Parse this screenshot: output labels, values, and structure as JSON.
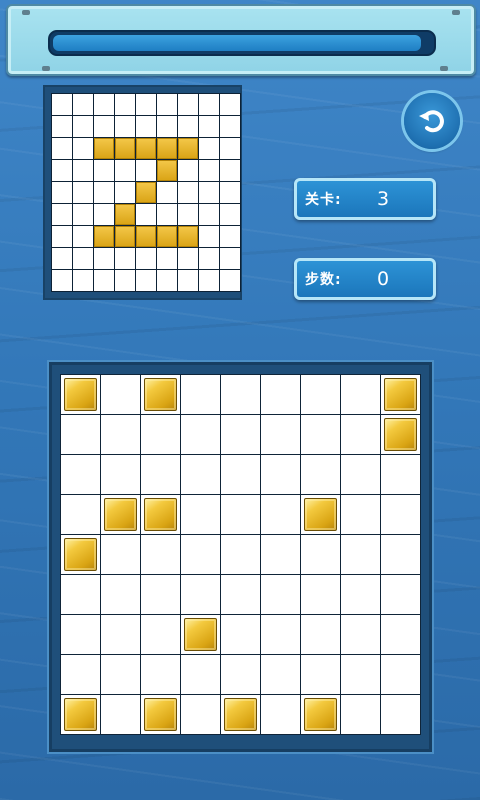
{
  "progress": {
    "fraction": 0.99
  },
  "level": {
    "label": "关卡:",
    "value": "3"
  },
  "steps": {
    "label": "步数:",
    "value": "0"
  },
  "refresh": {
    "icon": "refresh-icon"
  },
  "preview_grid": {
    "rows": 9,
    "cols": 9,
    "filled": [
      [
        2,
        2
      ],
      [
        2,
        3
      ],
      [
        2,
        4
      ],
      [
        2,
        5
      ],
      [
        2,
        6
      ],
      [
        3,
        5
      ],
      [
        4,
        4
      ],
      [
        5,
        3
      ],
      [
        6,
        2
      ],
      [
        6,
        3
      ],
      [
        6,
        4
      ],
      [
        6,
        5
      ],
      [
        6,
        6
      ]
    ]
  },
  "board_grid": {
    "rows": 9,
    "cols": 9,
    "filled": [
      [
        0,
        0
      ],
      [
        0,
        2
      ],
      [
        0,
        8
      ],
      [
        1,
        8
      ],
      [
        3,
        1
      ],
      [
        3,
        2
      ],
      [
        3,
        6
      ],
      [
        4,
        0
      ],
      [
        6,
        3
      ],
      [
        8,
        0
      ],
      [
        8,
        2
      ],
      [
        8,
        4
      ],
      [
        8,
        6
      ]
    ]
  },
  "colors": {
    "tile": "#e8b420",
    "background": "#3a7fc1"
  }
}
